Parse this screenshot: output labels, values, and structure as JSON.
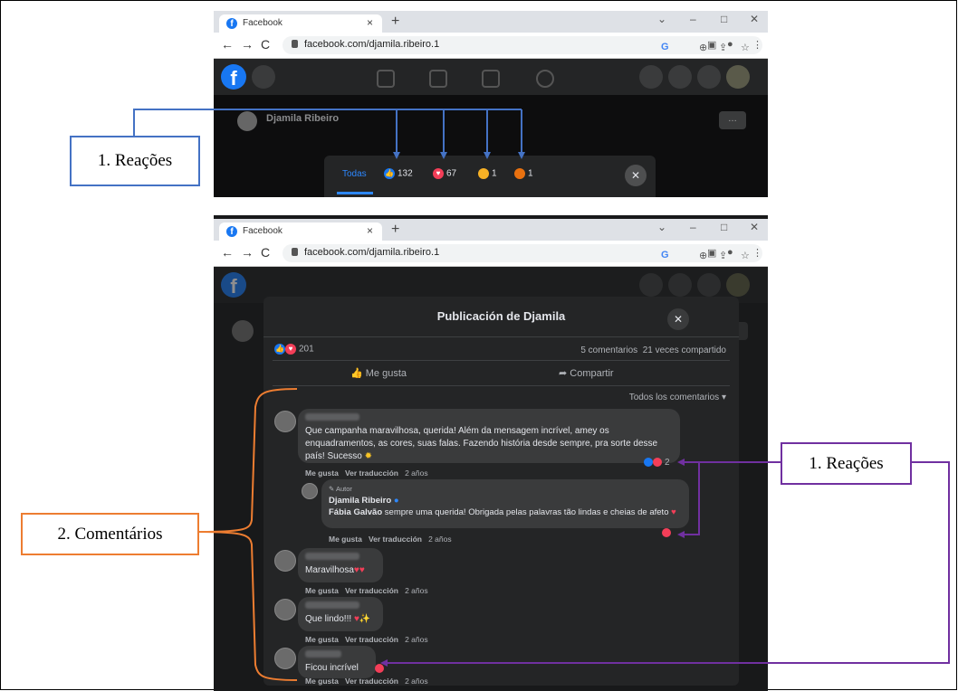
{
  "top": {
    "tab_title": "Facebook",
    "url": "facebook.com/djamila.ribeiro.1",
    "profile_name": "Djamila Ribeiro",
    "reactions_tab": "Todas",
    "reaction_counts": {
      "like": "132",
      "love": "67",
      "haha": "1",
      "angry": "1"
    }
  },
  "bottom": {
    "tab_title": "Facebook",
    "url": "facebook.com/djamila.ribeiro.1",
    "modal_title": "Publicación de Djamila",
    "reaction_total": "201",
    "comments_count": "5 comentarios",
    "shares_count": "21 veces compartido",
    "like_button": "Me gusta",
    "share_button": "Compartir",
    "filter": "Todos los comentarios",
    "comments": [
      {
        "text": "Que campanha maravilhosa, querida! Além da mensagem incrível, amey os enquadramentos, as cores, suas falas. Fazendo história desde sempre, pra sorte desse país! Sucesso",
        "reactions": "2"
      },
      {
        "author_badge": "Autor",
        "author": "Djamila Ribeiro",
        "mention": "Fábia Galvão",
        "text": "sempre uma querida! Obrigada pelas palavras tão lindas e cheias de afeto"
      },
      {
        "text": "Maravilhosa"
      },
      {
        "text": "Que lindo!!!"
      },
      {
        "text": "Ficou incrível"
      }
    ],
    "meta": {
      "like": "Me gusta",
      "translate": "Ver traducción",
      "age": "2 años"
    }
  },
  "annotations": {
    "label_reacoes": "1. Reações",
    "label_comentarios": "2. Comentários",
    "color_blue": "#4472c4",
    "color_purple": "#7030a0",
    "color_orange": "#ed7d31"
  }
}
